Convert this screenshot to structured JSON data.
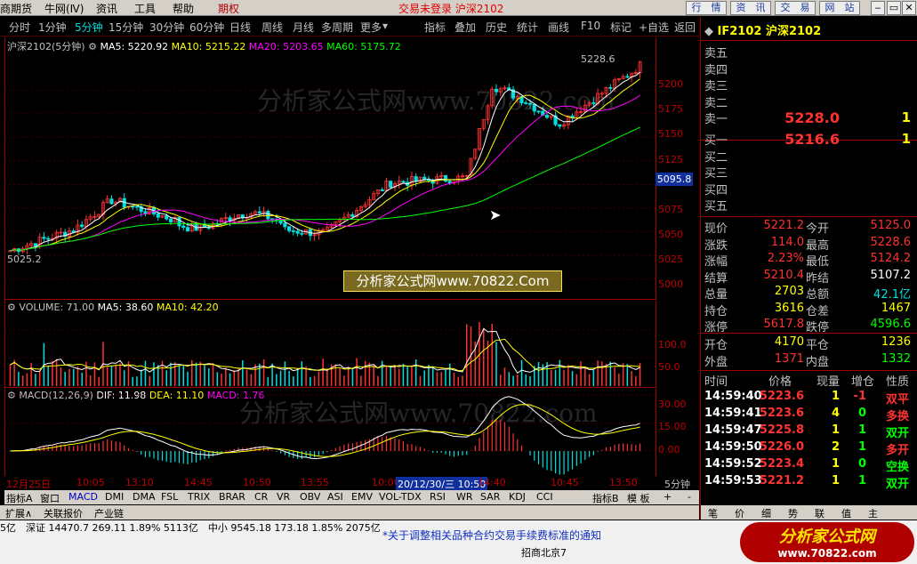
{
  "menu": {
    "items": [
      "商期货",
      "牛网(Ⅳ)",
      "资讯",
      "工具",
      "帮助",
      "期权"
    ],
    "title": "交易未登录 沪深2102",
    "right_buttons": [
      "行　情",
      "资　讯",
      "交　易",
      "网　站"
    ]
  },
  "period_bar": {
    "left": [
      "分时",
      "1分钟",
      "5分钟",
      "15分钟",
      "30分钟",
      "60分钟",
      "日线",
      "周线",
      "月线",
      "多周期",
      "更多"
    ],
    "right": [
      "指标",
      "叠加",
      "历史",
      "统计",
      "画线",
      "F10",
      "标记",
      "+自选",
      "返回"
    ]
  },
  "main_chart": {
    "name": "沪深2102(5分钟)",
    "ma5": "MA5: 5220.92",
    "ma10": "MA10: 5215.22",
    "ma20": "MA20: 5203.65",
    "ma60": "MA60: 5175.72",
    "high_label": "5228.6",
    "low_label": "5025.2",
    "cursor_price": "5095.8",
    "y_ticks": [
      "5200",
      "5175",
      "5150",
      "5125",
      "5100",
      "5075",
      "5050",
      "5025",
      "5000"
    ],
    "watermark": "分析家公式网www.70822.com",
    "banner": "分析家公式网www.70822.Com"
  },
  "volume_chart": {
    "label": "VOLUME: 71.00",
    "ma5": "MA5: 38.60",
    "ma10": "MA10: 42.20",
    "y_ticks": [
      "100.0",
      "50.0"
    ]
  },
  "macd_chart": {
    "label": "MACD(12,26,9)",
    "dif": "DIF: 11.98",
    "dea": "DEA: 11.10",
    "macd": "MACD: 1.76",
    "y_ticks": [
      "30.00",
      "15.00",
      "0.00"
    ],
    "watermark": "分析家公式网www.70822.com"
  },
  "time_axis": {
    "labels": [
      "12月25日",
      "10:05",
      "13:10",
      "14:45",
      "10:50",
      "13:55",
      "10:00",
      "14:40",
      "10:45",
      "13:50"
    ],
    "highlight": "20/12/30/三 10:50",
    "period": "5分钟"
  },
  "indicator_tabs": [
    "指标A",
    "窗口",
    "MACD",
    "DMI",
    "DMA",
    "FSL",
    "TRIX",
    "BRAR",
    "CR",
    "VR",
    "OBV",
    "ASI",
    "EMV",
    "VOL-TDX",
    "RSI",
    "WR",
    "SAR",
    "KDJ",
    "CCI",
    "指标B",
    "模 板",
    "+",
    "-"
  ],
  "status_tabs": [
    "扩展∧",
    "关联报价",
    "产业链"
  ],
  "quote_panel": {
    "title": "IF2102 沪深2102",
    "asks": [
      {
        "label": "卖五",
        "price": "",
        "vol": ""
      },
      {
        "label": "卖四",
        "price": "",
        "vol": ""
      },
      {
        "label": "卖三",
        "price": "",
        "vol": ""
      },
      {
        "label": "卖二",
        "price": "",
        "vol": ""
      },
      {
        "label": "卖一",
        "price": "5228.0",
        "vol": "1"
      }
    ],
    "bids": [
      {
        "label": "买一",
        "price": "5216.6",
        "vol": "1"
      },
      {
        "label": "买二",
        "price": "",
        "vol": ""
      },
      {
        "label": "买三",
        "price": "",
        "vol": ""
      },
      {
        "label": "买四",
        "price": "",
        "vol": ""
      },
      {
        "label": "买五",
        "price": "",
        "vol": ""
      }
    ],
    "stats": [
      {
        "l1": "现价",
        "v1": "5221.2",
        "l2": "今开",
        "v2": "5125.0"
      },
      {
        "l1": "涨跌",
        "v1": "114.0",
        "l2": "最高",
        "v2": "5228.6"
      },
      {
        "l1": "涨幅",
        "v1": "2.23%",
        "l2": "最低",
        "v2": "5124.2"
      },
      {
        "l1": "结算",
        "v1": "5210.4",
        "l2": "昨结",
        "v2": "5107.2"
      },
      {
        "l1": "总量",
        "v1": "2703",
        "l2": "总额",
        "v2": "42.1亿"
      },
      {
        "l1": "持仓",
        "v1": "3616",
        "l2": "仓差",
        "v2": "1467"
      },
      {
        "l1": "涨停",
        "v1": "5617.8",
        "l2": "跌停",
        "v2": "4596.6"
      }
    ],
    "stats2": [
      {
        "l1": "开仓",
        "v1": "4170",
        "l2": "平仓",
        "v2": "1236"
      },
      {
        "l1": "外盘",
        "v1": "1371",
        "l2": "内盘",
        "v2": "1332"
      }
    ],
    "trade_headers": [
      "时间",
      "价格",
      "现量",
      "增仓",
      "性质"
    ],
    "trades": [
      {
        "time": "14:59:40",
        "price": "5223.6",
        "vol": "1",
        "oi": "-1",
        "type": "双平"
      },
      {
        "time": "14:59:41",
        "price": "5223.6",
        "vol": "4",
        "oi": "0",
        "type": "多换"
      },
      {
        "time": "14:59:47",
        "price": "5225.8",
        "vol": "1",
        "oi": "1",
        "type": "双开"
      },
      {
        "time": "14:59:50",
        "price": "5226.0",
        "vol": "2",
        "oi": "1",
        "type": "多开"
      },
      {
        "time": "14:59:52",
        "price": "5223.4",
        "vol": "1",
        "oi": "0",
        "type": "空换"
      },
      {
        "time": "14:59:53",
        "price": "5221.2",
        "vol": "1",
        "oi": "1",
        "type": "双开"
      }
    ],
    "bottom_tabs": [
      "笔",
      "价",
      "细",
      "势",
      "联",
      "值",
      "主"
    ]
  },
  "status_bar": {
    "text": "5亿　深证 14470.7  269.11  1.89%  5113亿　中小 9545.18  173.18  1.85%  2075亿",
    "extra": "招商北京7"
  },
  "news": "*关于调整相关品种合约交易手续费标准的通知",
  "logo": {
    "line1": "分析家公式网",
    "line2": "www.70822.com"
  },
  "colors": {
    "up": "#ff3232",
    "down": "#00e0e0",
    "ma5": "#ffffff",
    "ma10": "#ffff00",
    "ma20": "#ff00ff",
    "ma60": "#00ff00",
    "accent": "#e00000"
  }
}
